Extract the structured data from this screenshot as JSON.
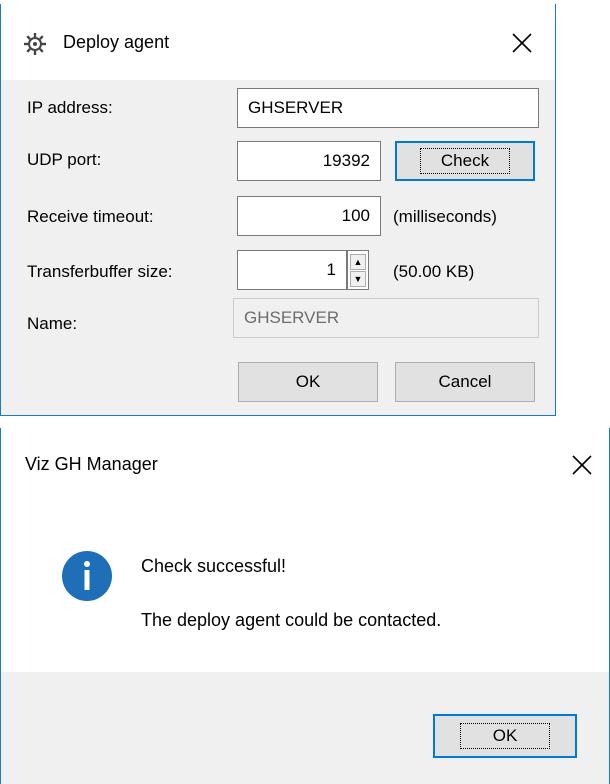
{
  "deploy_dialog": {
    "title": "Deploy agent",
    "fields": {
      "ip_label": "IP address:",
      "ip_value": "GHSERVER",
      "udp_label": "UDP port:",
      "udp_value": "19392",
      "check_label": "Check",
      "timeout_label": "Receive timeout:",
      "timeout_value": "100",
      "timeout_unit": "(milliseconds)",
      "buffer_label": "Transferbuffer size:",
      "buffer_value": "1",
      "buffer_unit": "(50.00 KB)",
      "name_label": "Name:",
      "name_value": "GHSERVER"
    },
    "ok_label": "OK",
    "cancel_label": "Cancel"
  },
  "message_dialog": {
    "title": "Viz GH Manager",
    "message_title": "Check successful!",
    "message_body": "The deploy agent could be contacted.",
    "ok_label": "OK"
  },
  "colors": {
    "accent": "#0078d7",
    "info_icon": "#1e6fb8",
    "window_bg": "#f0f0f0"
  },
  "icons": {
    "app": "gear-icon",
    "close": "close-icon",
    "info": "info-icon",
    "spin_up": "arrow-up-icon",
    "spin_down": "arrow-down-icon"
  }
}
